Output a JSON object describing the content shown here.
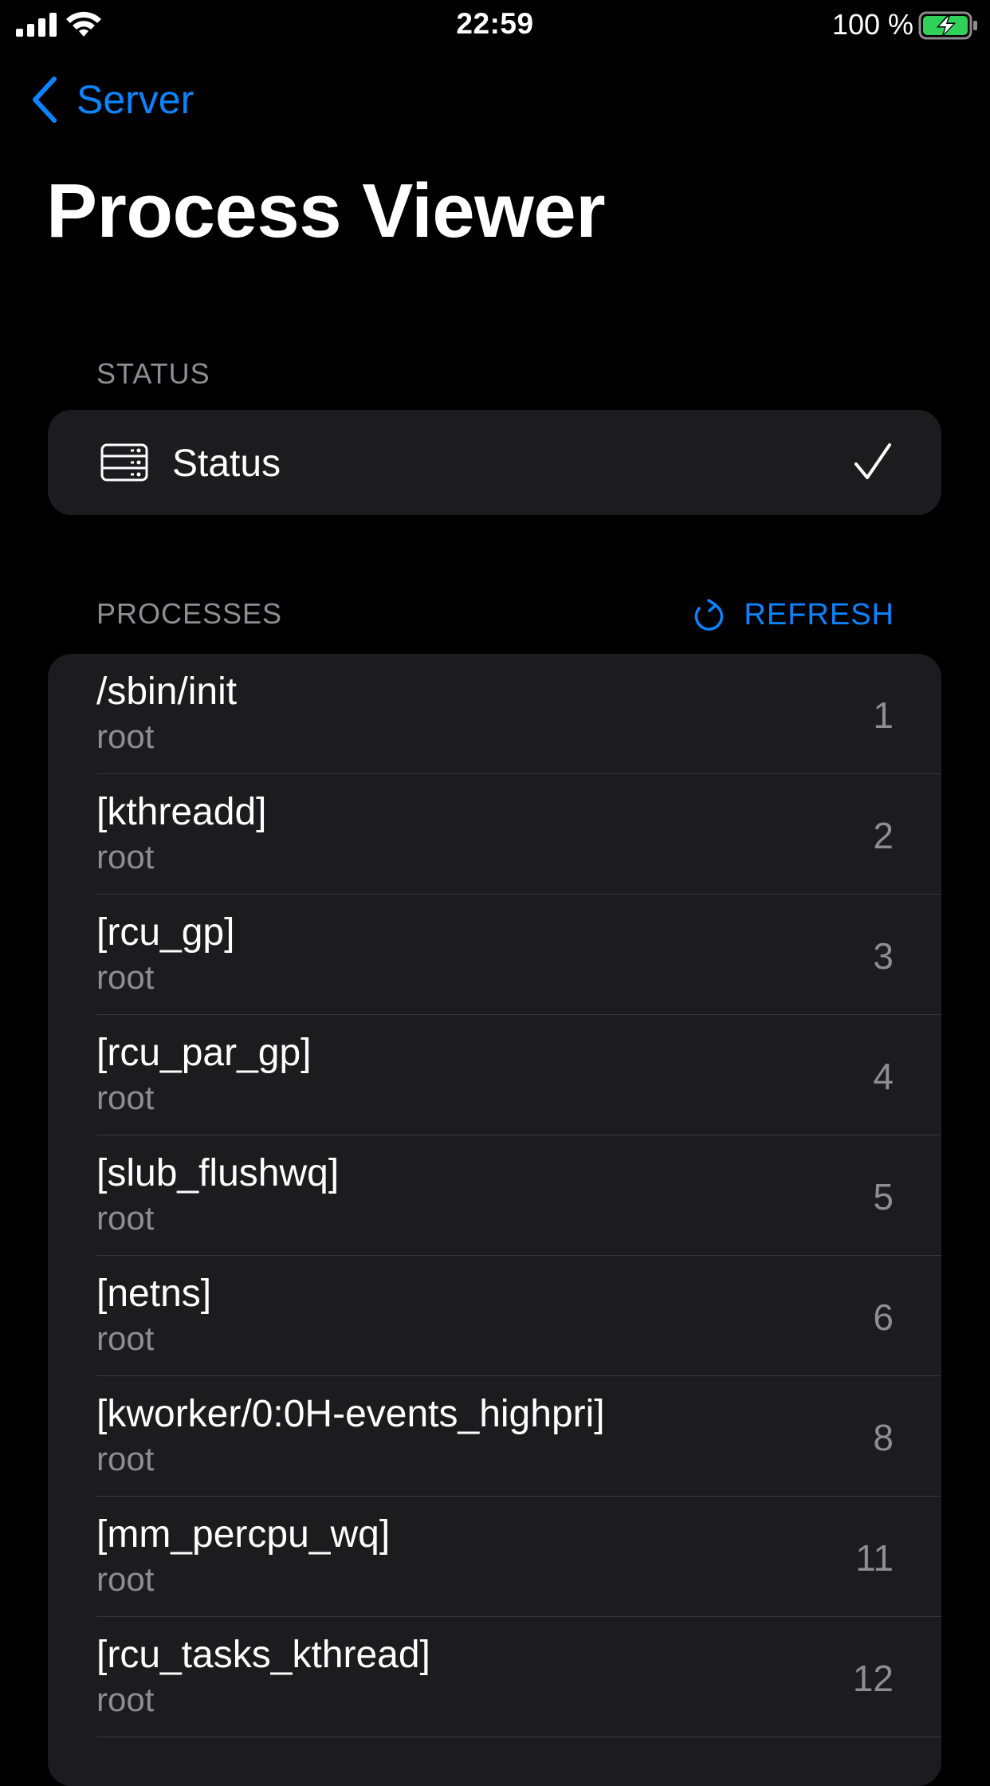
{
  "status_bar": {
    "time": "22:59",
    "battery_percent": "100 %",
    "battery_charging": true
  },
  "nav": {
    "back_label": "Server",
    "title": "Process Viewer"
  },
  "status_section": {
    "header": "STATUS",
    "item_label": "Status",
    "item_icon": "server-icon",
    "checked": true
  },
  "processes_section": {
    "header": "PROCESSES",
    "refresh_label": "REFRESH",
    "refresh_icon": "refresh-icon",
    "rows": [
      {
        "name": "/sbin/init",
        "user": "root",
        "pid": "1"
      },
      {
        "name": "[kthreadd]",
        "user": "root",
        "pid": "2"
      },
      {
        "name": "[rcu_gp]",
        "user": "root",
        "pid": "3"
      },
      {
        "name": "[rcu_par_gp]",
        "user": "root",
        "pid": "4"
      },
      {
        "name": "[slub_flushwq]",
        "user": "root",
        "pid": "5"
      },
      {
        "name": "[netns]",
        "user": "root",
        "pid": "6"
      },
      {
        "name": "[kworker/0:0H-events_highpri]",
        "user": "root",
        "pid": "8"
      },
      {
        "name": "[mm_percpu_wq]",
        "user": "root",
        "pid": "11"
      },
      {
        "name": "[rcu_tasks_kthread]",
        "user": "root",
        "pid": "12"
      }
    ]
  },
  "colors": {
    "background": "#000000",
    "card": "#1c1c1e",
    "accent": "#0a84ff",
    "secondary_text": "#8d8d93",
    "separator": "#38383a",
    "battery_fill": "#30d158"
  }
}
